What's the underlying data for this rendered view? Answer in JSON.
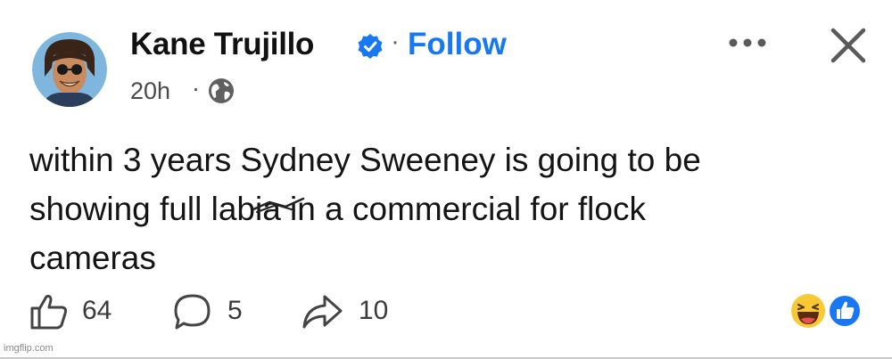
{
  "header": {
    "author_name": "Kane Trujillo",
    "separator": "·",
    "follow_label": "Follow",
    "timestamp": "20h",
    "time_separator": "·",
    "verified": true
  },
  "post": {
    "text": "within 3 years Sydney Sweeney is going to be\nshowing full labia in a commercial for flock\ncameras"
  },
  "actions": {
    "likes": "64",
    "comments": "5",
    "shares": "10"
  },
  "reactions": [
    "laughing-emoji",
    "like-icon"
  ],
  "watermark": "imgflip.com",
  "colors": {
    "accent": "#1877f2",
    "text": "#141414",
    "muted": "#65676b"
  }
}
